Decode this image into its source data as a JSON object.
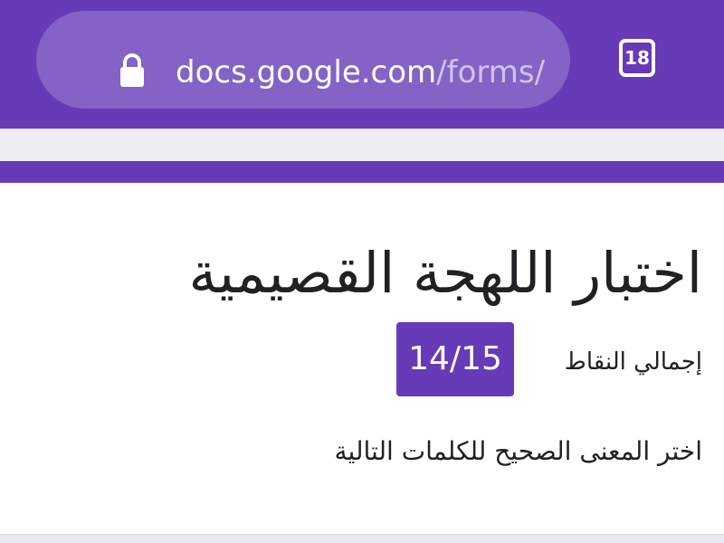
{
  "browser": {
    "url_host": "docs.google.com",
    "url_path": "/forms/",
    "tab_count": "18",
    "icons": {
      "lock": "lock-icon",
      "tabs": "tabs-counter-icon"
    },
    "colors": {
      "toolbar": "#673ab7",
      "url_pill": "#8562c5"
    }
  },
  "form": {
    "title": "اختبار اللهجة القصيمية",
    "score_label": "إجمالي النقاط",
    "score_value": "14/15",
    "description": "اختر المعنى الصحيح للكلمات التالية",
    "colors": {
      "accent": "#673ab7",
      "text": "#202124"
    }
  }
}
